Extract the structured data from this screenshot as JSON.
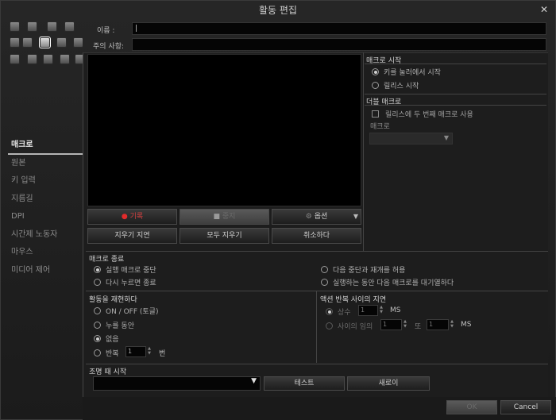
{
  "window": {
    "title": "활동 편집",
    "close_icon": "close-icon"
  },
  "form": {
    "name_label": "이름 :",
    "note_label": "주의 사항:"
  },
  "nav": {
    "items": [
      {
        "label": "매크로",
        "active": true
      },
      {
        "label": "원본"
      },
      {
        "label": "키 입력"
      },
      {
        "label": "지름길"
      },
      {
        "label": "DPI"
      },
      {
        "label": "시간제 노동자"
      },
      {
        "label": "마우스"
      },
      {
        "label": "미디어 제어"
      }
    ]
  },
  "record_toolbar": {
    "record": "기록",
    "stop": "중지",
    "options": "옵션",
    "clear_delay": "지우기 지연",
    "clear_all": "모두 지우기",
    "cancel": "취소하다"
  },
  "macro_start": {
    "title": "매크로 시작",
    "options": [
      "키를 눌러에서 시작",
      "릴리스 시작"
    ],
    "selected": 0
  },
  "double_macro": {
    "title": "더블 매크로",
    "checkbox": "릴리스에 두 번째 매크로 사용",
    "macro_label": "매크로"
  },
  "macro_end": {
    "title": "매크로 종료",
    "options": [
      "실행 매크로 중단",
      "다시 누르면 종료",
      "다음 중단과 재개를 허용",
      "실행하는 동안 다음 매크로를 대기열하다"
    ],
    "selected": 0
  },
  "playback": {
    "title": "활동을 재현하다",
    "options": [
      "ON / OFF (토글)",
      "누를 동안",
      "없음",
      "반복"
    ],
    "selected": 2,
    "repeat_count": "1",
    "repeat_unit": "번"
  },
  "delay": {
    "title": "액션 반복 사이의 지연",
    "constant_label": "상수",
    "constant_value": "1",
    "random_label": "사이의 임의",
    "random_from": "1",
    "and_label": "또",
    "random_to": "1",
    "unit": "MS"
  },
  "lighting": {
    "title": "조명 때 시작",
    "test": "테스트",
    "refresh": "새로이"
  },
  "footer": {
    "ok": "OK",
    "cancel": "Cancel"
  }
}
